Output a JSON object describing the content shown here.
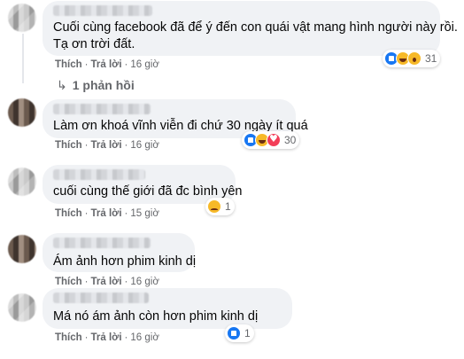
{
  "comments": [
    {
      "text_lines": [
        "Cuối cùng facebook đã để ý đến con quái vật mang hình người này rồi.",
        "Tạ ơn trời đất."
      ],
      "like": "Thích",
      "reply": "Trả lời",
      "time": "16 giờ",
      "reactions": [
        "like",
        "haha",
        "wow"
      ],
      "reaction_count": "31"
    },
    {
      "text_lines": [
        "Làm ơn khoá vĩnh viễn đi chứ 30 ngày ít quá"
      ],
      "like": "Thích",
      "reply": "Trả lời",
      "time": "16 giờ",
      "reactions": [
        "like",
        "haha",
        "love"
      ],
      "reaction_count": "30"
    },
    {
      "text_lines": [
        "cuối cùng thế giới đã đc bình yên"
      ],
      "like": "Thích",
      "reply": "Trả lời",
      "time": "15 giờ",
      "reactions": [
        "sad"
      ],
      "reaction_count": "1"
    },
    {
      "text_lines": [
        "Ám ảnh hơn phim kinh dị"
      ],
      "like": "Thích",
      "reply": "Trả lời",
      "time": "16 giờ",
      "reactions": [],
      "reaction_count": ""
    },
    {
      "text_lines": [
        "Má nó ám ảnh còn hơn phim kinh dị"
      ],
      "like": "Thích",
      "reply": "Trả lời",
      "time": "16 giờ",
      "reactions": [
        "like"
      ],
      "reaction_count": "1"
    }
  ],
  "replies_toggle": {
    "arrow": "↳",
    "label": "1 phản hồi"
  },
  "separator": "·",
  "colors": {
    "bubble": "#f0f2f5",
    "text": "#050505",
    "meta": "#65676b",
    "like_blue": "#1877f2",
    "love_red": "#f33e58",
    "emoji_yellow": "#f7b928"
  }
}
